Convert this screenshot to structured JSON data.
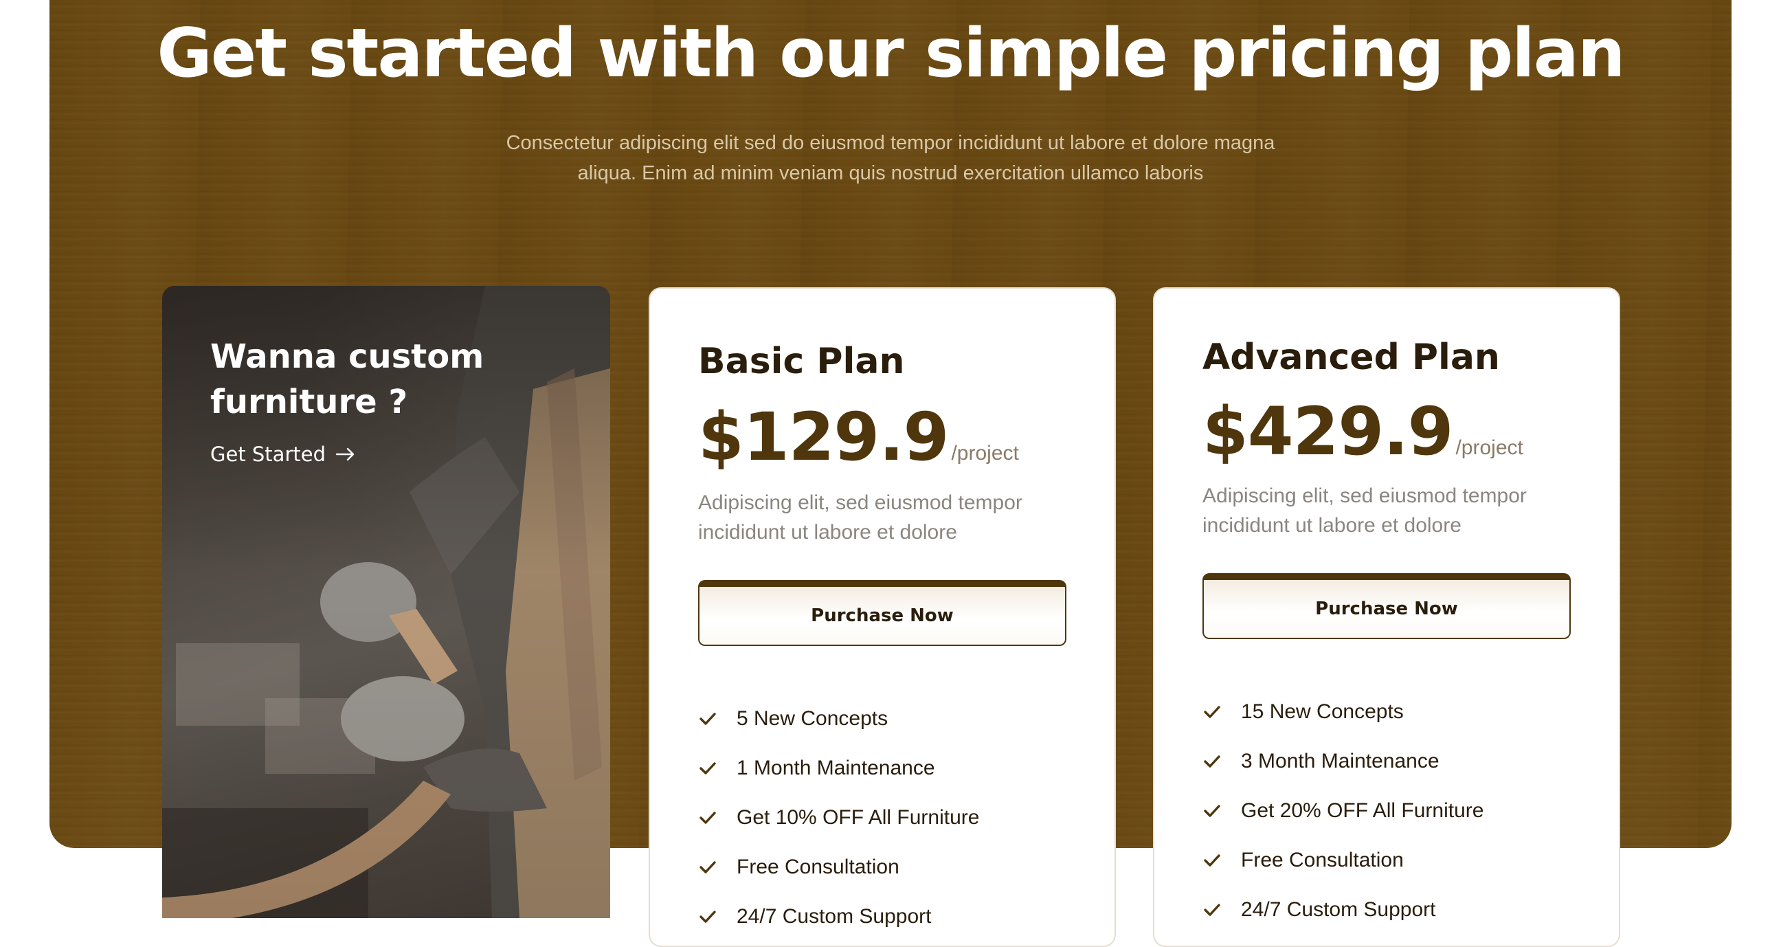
{
  "hero": {
    "title": "Get started with our simple pricing plan",
    "subtitle_line1": "Consectetur adipiscing elit sed do eiusmod tempor incididunt ut labore et dolore magna",
    "subtitle_line2": "aliqua. Enim ad minim veniam quis nostrud exercitation ullamco laboris"
  },
  "promo": {
    "title_line1": "Wanna custom",
    "title_line2": "furniture ?",
    "link_label": "Get Started",
    "link_icon": "arrow-right-icon"
  },
  "plans": [
    {
      "name": "Basic Plan",
      "price": "$129.9",
      "per": "/project",
      "desc_line1": "Adipiscing elit, sed eiusmod tempor",
      "desc_line2": "incididunt ut labore et dolore",
      "button": "Purchase Now",
      "features": [
        "5 New Concepts",
        "1 Month Maintenance",
        "Get 10% OFF All Furniture",
        "Free Consultation",
        "24/7 Custom Support"
      ]
    },
    {
      "name": "Advanced Plan",
      "price": "$429.9",
      "per": "/project",
      "desc_line1": "Adipiscing elit, sed eiusmod tempor",
      "desc_line2": "incididunt ut labore et dolore",
      "button": "Purchase Now",
      "features": [
        "15 New Concepts",
        "3 Month Maintenance",
        "Get 20% OFF All Furniture",
        "Free Consultation",
        "24/7 Custom Support"
      ]
    }
  ],
  "colors": {
    "section_bg": "#6b4a13",
    "accent": "#4f360c",
    "heading_dark": "#2a1d0c"
  },
  "icons": {
    "feature": "check-icon"
  }
}
